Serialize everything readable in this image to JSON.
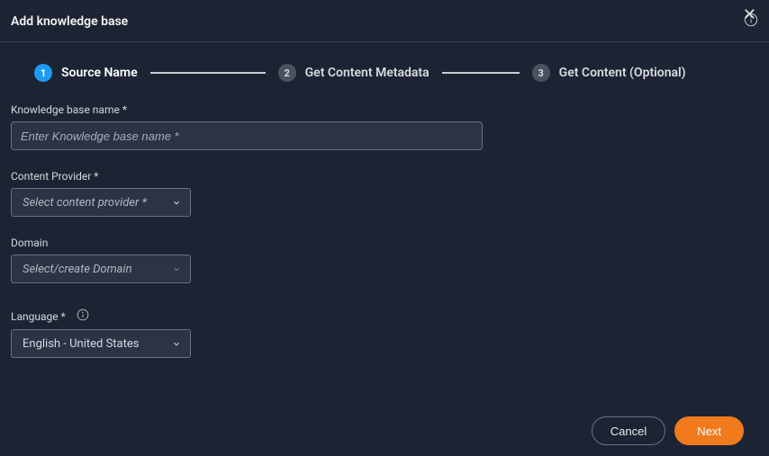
{
  "header": {
    "title": "Add knowledge base"
  },
  "stepper": {
    "steps": [
      {
        "num": "1",
        "label": "Source Name",
        "active": true
      },
      {
        "num": "2",
        "label": "Get Content Metadata",
        "active": false
      },
      {
        "num": "3",
        "label": "Get Content (Optional)",
        "active": false
      }
    ]
  },
  "form": {
    "kbName": {
      "label": "Knowledge base name *",
      "placeholder": "Enter Knowledge base name *"
    },
    "contentProvider": {
      "label": "Content Provider *",
      "placeholder": "Select content provider *"
    },
    "domain": {
      "label": "Domain",
      "placeholder": "Select/create Domain"
    },
    "language": {
      "label": "Language *",
      "value": "English - United States"
    }
  },
  "footer": {
    "cancel": "Cancel",
    "next": "Next"
  }
}
